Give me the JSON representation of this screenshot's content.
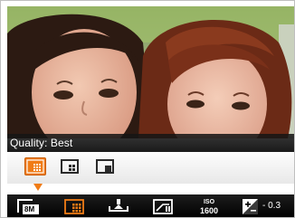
{
  "viewfinder": {
    "subject": "photo-of-two-women"
  },
  "settings_panel": {
    "title": "Quality: Best",
    "options": [
      {
        "name": "best",
        "icon": "quality-best-icon",
        "selected": true
      },
      {
        "name": "better",
        "icon": "quality-better-icon",
        "selected": false
      },
      {
        "name": "good",
        "icon": "quality-good-icon",
        "selected": false
      }
    ]
  },
  "menu_bar": {
    "items": [
      {
        "icon": "image-size-icon",
        "label": "8M"
      },
      {
        "icon": "quality-best-icon",
        "label": "",
        "selected": true
      },
      {
        "icon": "white-balance-icon",
        "label": ""
      },
      {
        "icon": "metering-icon",
        "label": ""
      },
      {
        "icon": "iso-icon",
        "label_top": "ISO",
        "label_bottom": "1600"
      },
      {
        "icon": "exposure-compensation-icon",
        "label": "- 0.3"
      }
    ]
  },
  "colors": {
    "accent": "#f07c16",
    "menu_bg": "#000000",
    "strip_bg": "#f4f4f4"
  }
}
